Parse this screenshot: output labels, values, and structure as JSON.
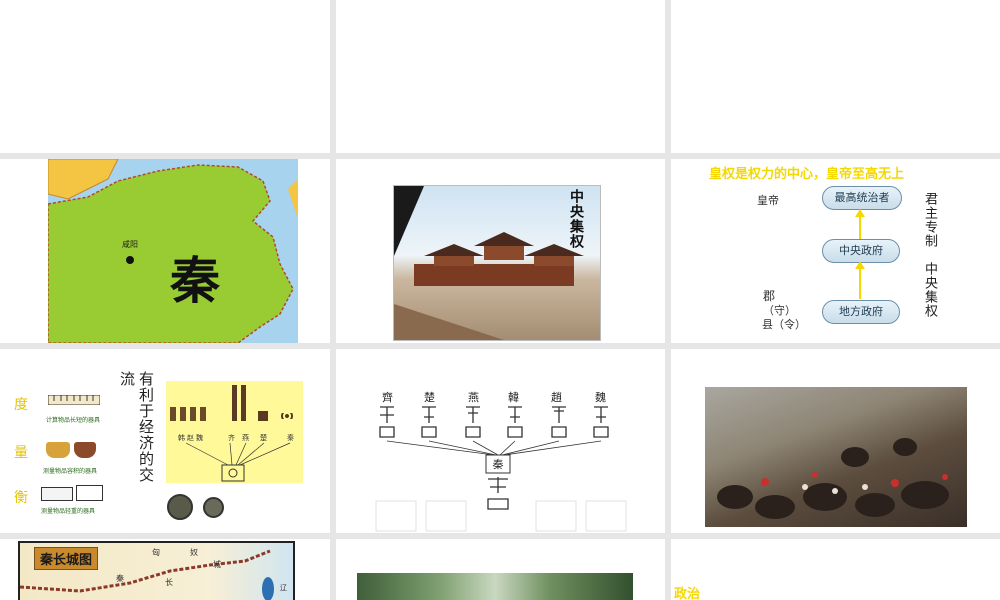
{
  "slides": {
    "qin_map": {
      "city": "咸阳",
      "state": "秦"
    },
    "palace": {
      "caption": "中央集权"
    },
    "hierarchy": {
      "title": "皇权是权力的中心，皇帝至高无上",
      "emperor_label": "皇帝",
      "commandery_label": "郡",
      "shou_label": "（守）",
      "county_label": "县（令）",
      "box_top": "最高统治者",
      "box_mid": "中央政府",
      "box_bottom": "地方政府",
      "side_right_1": "君主专制",
      "side_right_2": "中央集权"
    },
    "measures": {
      "du": "度",
      "liang": "量",
      "heng": "衡",
      "du_caption": "计算物品长短的器具",
      "liang_caption": "测量物品容积的器具",
      "heng_caption": "测量物品轻重的器具",
      "vertical_1": "有利于经济的交",
      "vertical_2": "流",
      "coin_states": [
        "韩",
        "赵",
        "魏",
        "齐",
        "燕",
        "楚",
        "秦"
      ]
    },
    "scripts": {
      "states": [
        "齊",
        "楚",
        "燕",
        "韓",
        "趙",
        "魏"
      ],
      "center": "秦"
    },
    "wall": {
      "title": "秦长城图",
      "labels": [
        "匈",
        "奴",
        "秦",
        "长",
        "城",
        "辽"
      ]
    },
    "politics": {
      "label": "政治"
    }
  },
  "colors": {
    "accent_yellow": "#f5d800",
    "map_green": "#99cc33",
    "heading_red": "#cc3300"
  }
}
